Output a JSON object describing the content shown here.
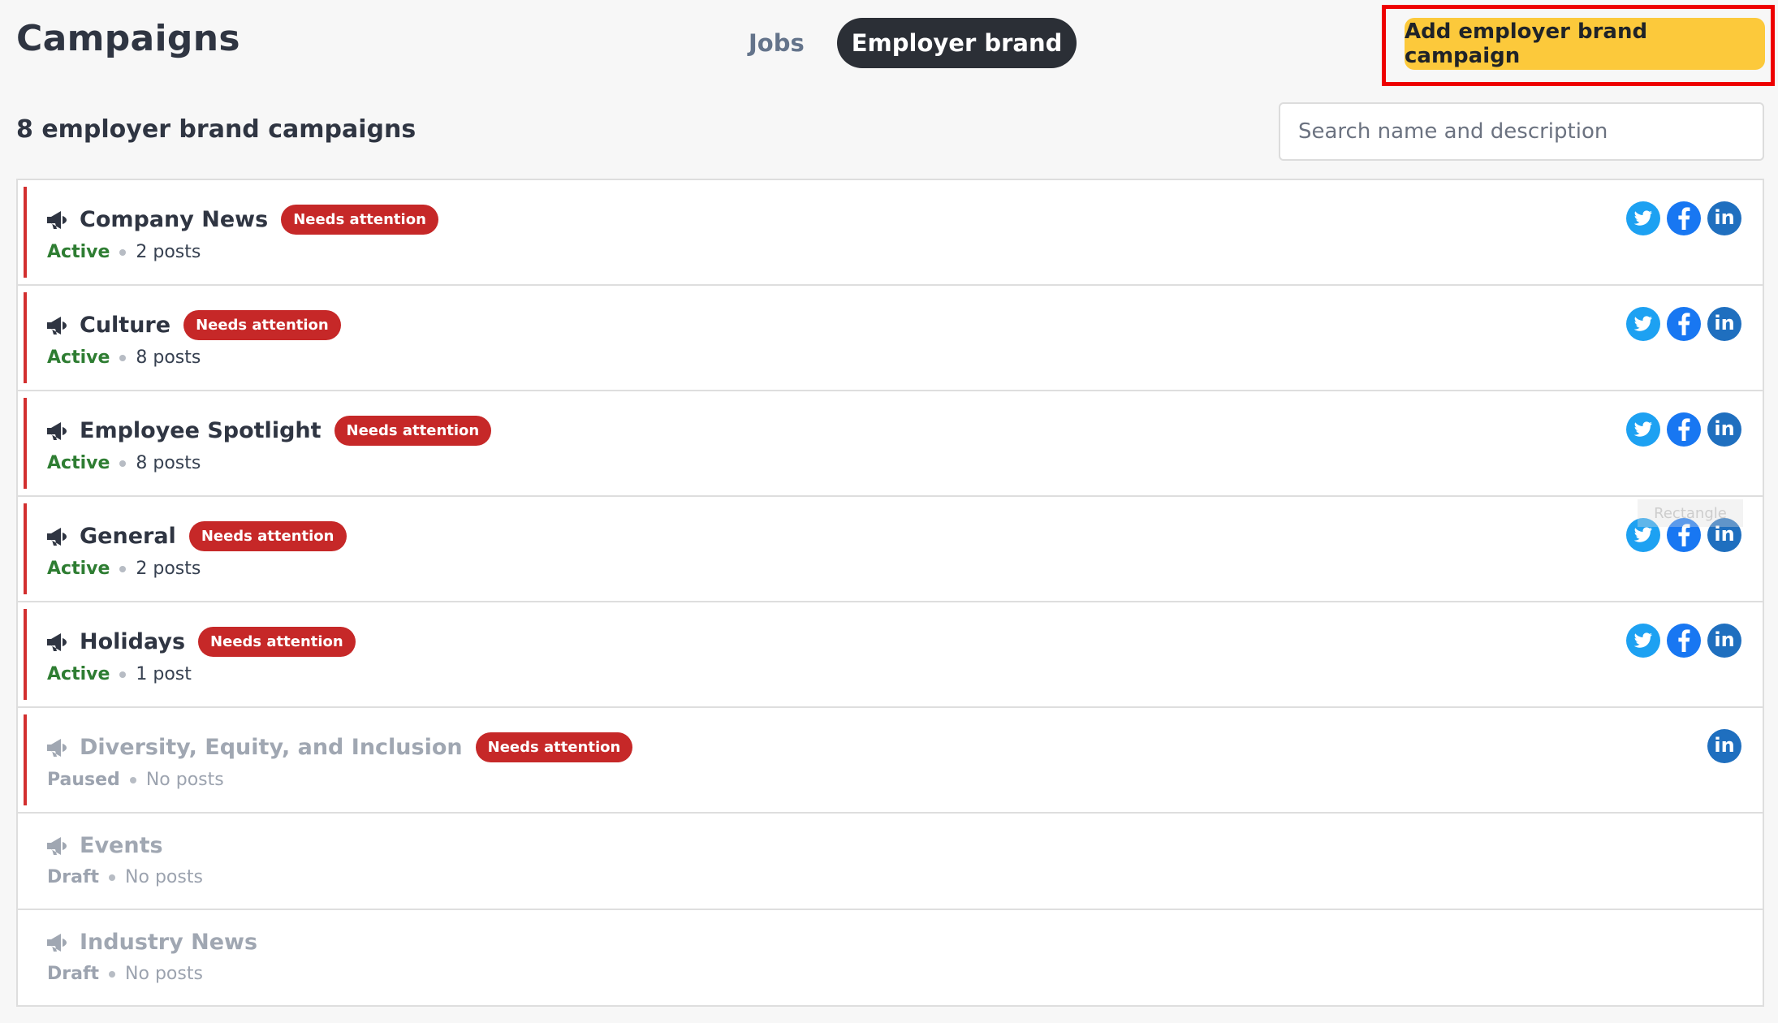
{
  "header": {
    "title": "Campaigns",
    "tabs": [
      {
        "label": "Jobs",
        "active": false
      },
      {
        "label": "Employer brand",
        "active": true
      }
    ],
    "add_button_label": "Add employer brand campaign"
  },
  "toolbar": {
    "count_heading": "8 employer brand campaigns",
    "search_placeholder": "Search name and description"
  },
  "campaigns": [
    {
      "name": "Company News",
      "badge": "Needs attention",
      "status": "Active",
      "posts": "2 posts",
      "channels": [
        "twitter",
        "facebook",
        "linkedin"
      ]
    },
    {
      "name": "Culture",
      "badge": "Needs attention",
      "status": "Active",
      "posts": "8 posts",
      "channels": [
        "twitter",
        "facebook",
        "linkedin"
      ]
    },
    {
      "name": "Employee Spotlight",
      "badge": "Needs attention",
      "status": "Active",
      "posts": "8 posts",
      "channels": [
        "twitter",
        "facebook",
        "linkedin"
      ]
    },
    {
      "name": "General",
      "badge": "Needs attention",
      "status": "Active",
      "posts": "2 posts",
      "channels": [
        "twitter",
        "facebook",
        "linkedin"
      ]
    },
    {
      "name": "Holidays",
      "badge": "Needs attention",
      "status": "Active",
      "posts": "1 post",
      "channels": [
        "twitter",
        "facebook",
        "linkedin"
      ]
    },
    {
      "name": "Diversity, Equity, and Inclusion",
      "badge": "Needs attention",
      "status": "Paused",
      "posts": "No posts",
      "channels": [
        "linkedin"
      ]
    },
    {
      "name": "Events",
      "badge": "",
      "status": "Draft",
      "posts": "No posts",
      "channels": []
    },
    {
      "name": "Industry News",
      "badge": "",
      "status": "Draft",
      "posts": "No posts",
      "channels": []
    }
  ],
  "overlay": {
    "ghost_label": "Rectangle"
  },
  "colors": {
    "accent_yellow": "#fcc93b",
    "attention_red": "#c62828",
    "active_green": "#2e7d32",
    "highlight_frame": "#ee0000",
    "twitter": "#1da1f2",
    "facebook": "#1877f2",
    "linkedin": "#1f6fbf"
  },
  "icons": {
    "campaign": "megaphone-icon",
    "twitter": "twitter-icon",
    "facebook": "facebook-icon",
    "linkedin": "linkedin-icon"
  }
}
